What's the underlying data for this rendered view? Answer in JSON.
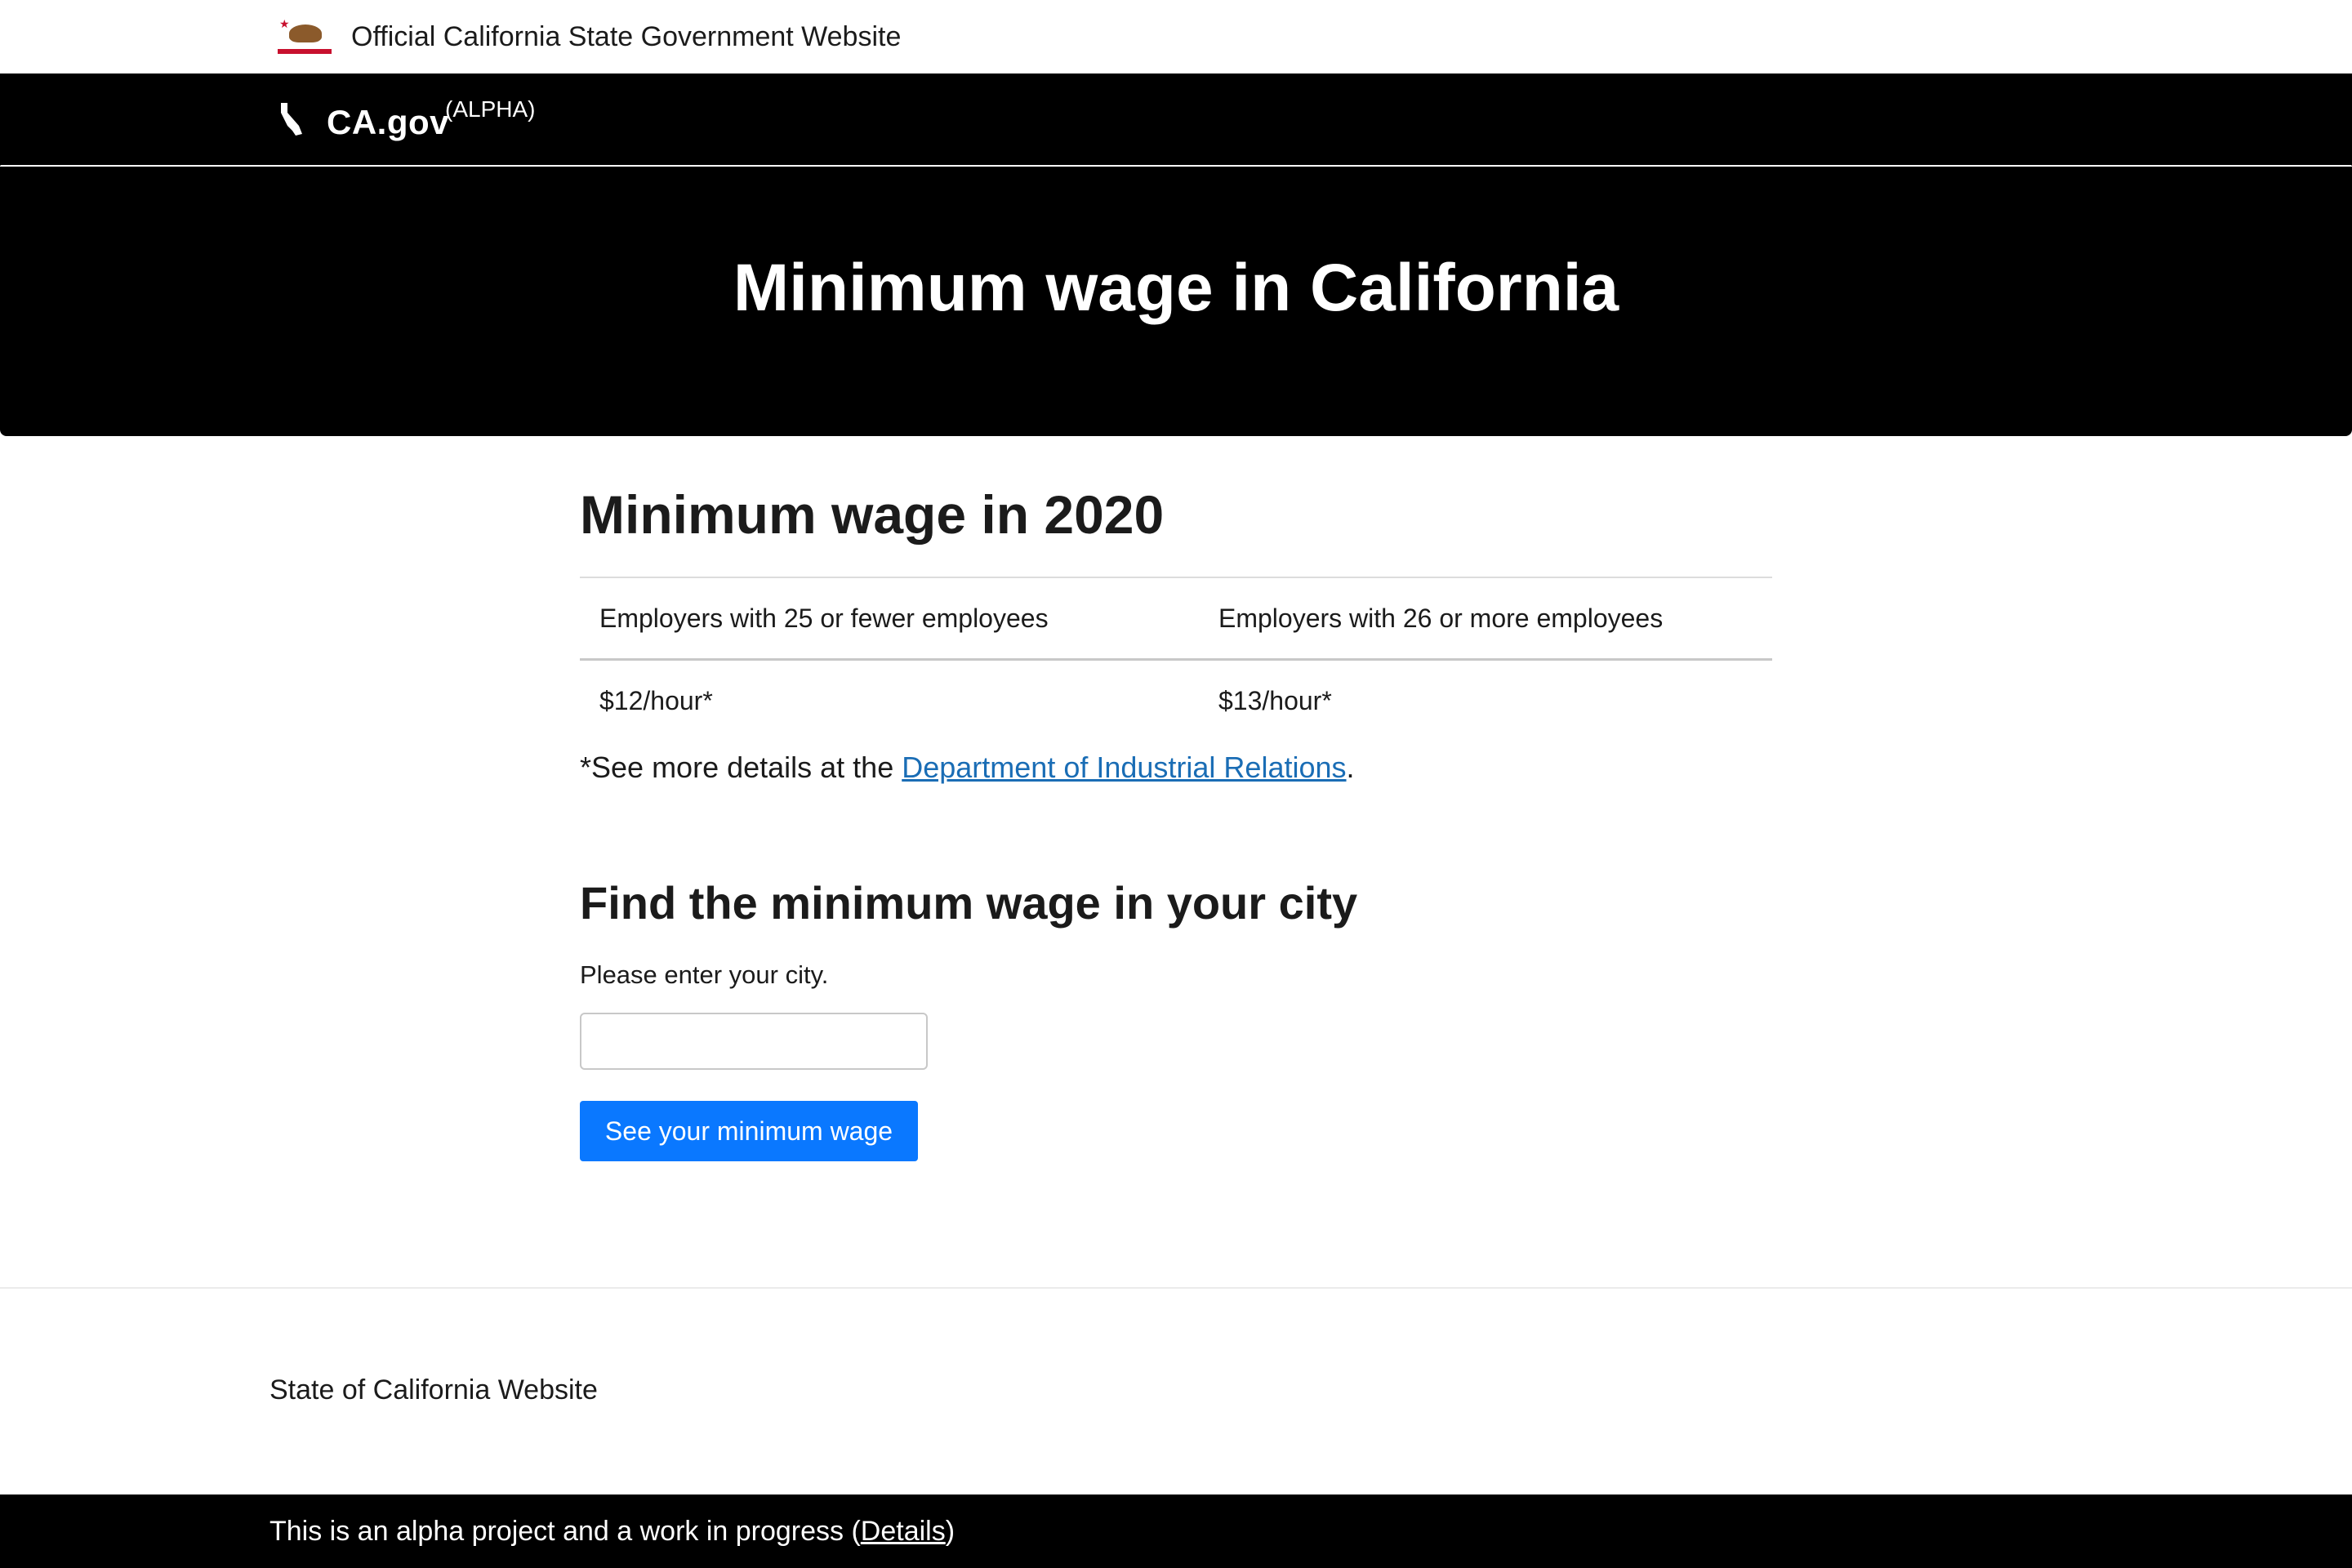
{
  "official_banner": {
    "text": "Official California State Government Website",
    "flag_icon": "california-flag-icon"
  },
  "header": {
    "brand": "CA.gov",
    "brand_sup": "(ALPHA)",
    "state_icon": "california-state-icon"
  },
  "hero": {
    "title": "Minimum wage in California"
  },
  "main": {
    "wage_title": "Minimum wage in 2020",
    "table": {
      "headers": [
        "Employers with 25 or fewer employees",
        "Employers with 26 or more employees"
      ],
      "rows": [
        [
          "$12/hour*",
          "$13/hour*"
        ]
      ]
    },
    "note_prefix": "*See more details at the ",
    "note_link": "Department of Industrial Relations",
    "note_suffix": ".",
    "city_title": "Find the minimum wage in your city",
    "city_label": "Please enter your city.",
    "city_input_value": "",
    "button_label": "See your minimum wage"
  },
  "footer": {
    "site_text": "State of California Website",
    "alpha_prefix": "This is an alpha project and a work in progress (",
    "alpha_link": "Details",
    "alpha_suffix": ")"
  },
  "colors": {
    "header_bg": "#000000",
    "link": "#1a6db5",
    "button_bg": "#0a78ff",
    "button_text": "#ffffff"
  }
}
